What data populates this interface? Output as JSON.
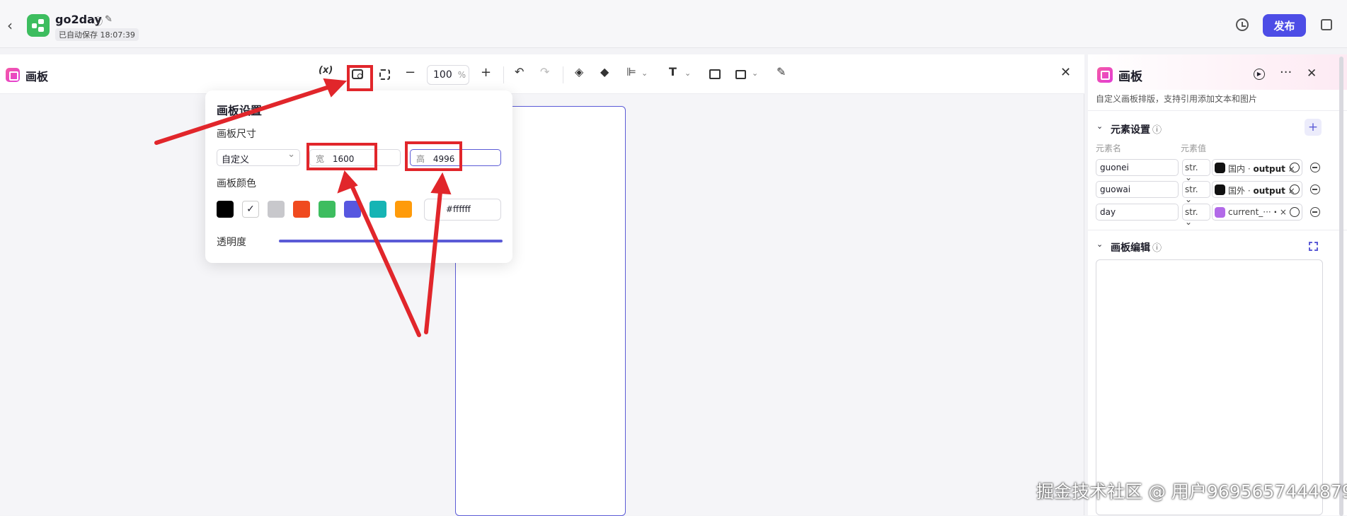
{
  "header": {
    "app_title": "go2day",
    "autosave": "已自动保存 18:07:39",
    "publish_label": "发布"
  },
  "canvas_panel": {
    "title": "画板",
    "variable_btn": "(x)",
    "zoom_value": "100",
    "zoom_unit": "%"
  },
  "popover": {
    "title": "画板设置",
    "size_label": "画板尺寸",
    "size_preset": "自定义",
    "width_prefix": "宽",
    "width_value": "1600",
    "height_prefix": "高",
    "height_value": "4996",
    "color_label": "画板颜色",
    "swatches": [
      "#000000",
      "#ffffff",
      "#c8c8cc",
      "#f04a1f",
      "#3dbd5f",
      "#5757e0",
      "#16b4b4",
      "#ff9b0a"
    ],
    "selected_swatch": "#ffffff",
    "hex_value": "#ffffff",
    "opacity_label": "透明度",
    "opacity": 1.0
  },
  "right_panel": {
    "title": "画板",
    "description": "自定义画板排版，支持引用添加文本和图片",
    "element_section": "元素设置",
    "col_name": "元素名",
    "col_value": "元素值",
    "rows": [
      {
        "name": "guonei",
        "type": "str.",
        "source": "国内 ·",
        "output": "output"
      },
      {
        "name": "guowai",
        "type": "str.",
        "source": "国外 ·",
        "output": "output"
      },
      {
        "name": "day",
        "type": "str.",
        "source": "current_···",
        "output": "·"
      }
    ],
    "edit_section": "画板编辑"
  },
  "watermark": "掘金技术社区 @ 用户9695657444879",
  "colors": {
    "accent": "#4d4de6",
    "annotation_red": "#e1262b",
    "app_logo": "#3dbd5f"
  }
}
